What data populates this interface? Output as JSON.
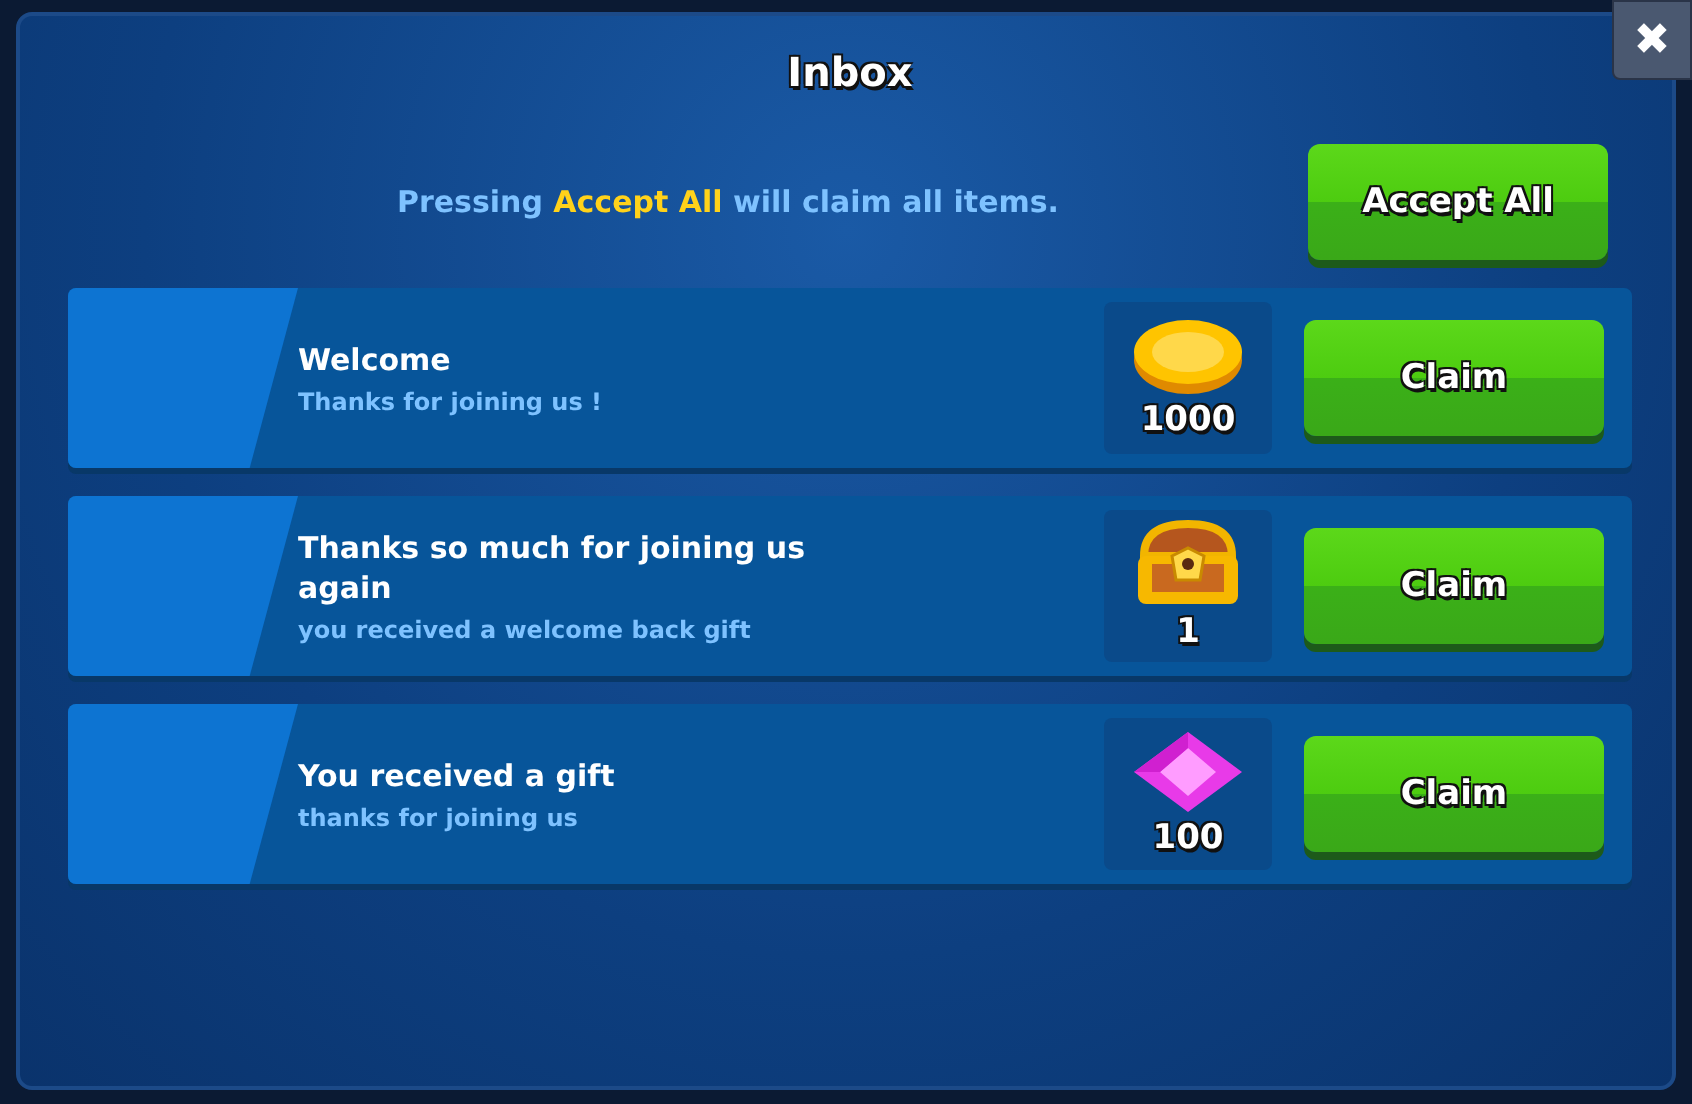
{
  "window": {
    "title": "Inbox",
    "close": "✖"
  },
  "info": {
    "text": "Pressing **Accept All** will claim all items.",
    "button": "Accept All"
  },
  "messages": [
    {
      "title": "Welcome",
      "subtitle": "Thanks for joining us !",
      "reward": {
        "kind": "coin",
        "amount": "1000"
      },
      "button": "Claim"
    },
    {
      "title": "Thanks so much for joining us again",
      "subtitle": "you received a welcome back gift",
      "reward": {
        "kind": "chest",
        "amount": "1"
      },
      "button": "Claim"
    },
    {
      "title": "You received a gift",
      "subtitle": "thanks for joining us",
      "reward": {
        "kind": "gem",
        "amount": "100"
      },
      "button": "Claim"
    }
  ]
}
